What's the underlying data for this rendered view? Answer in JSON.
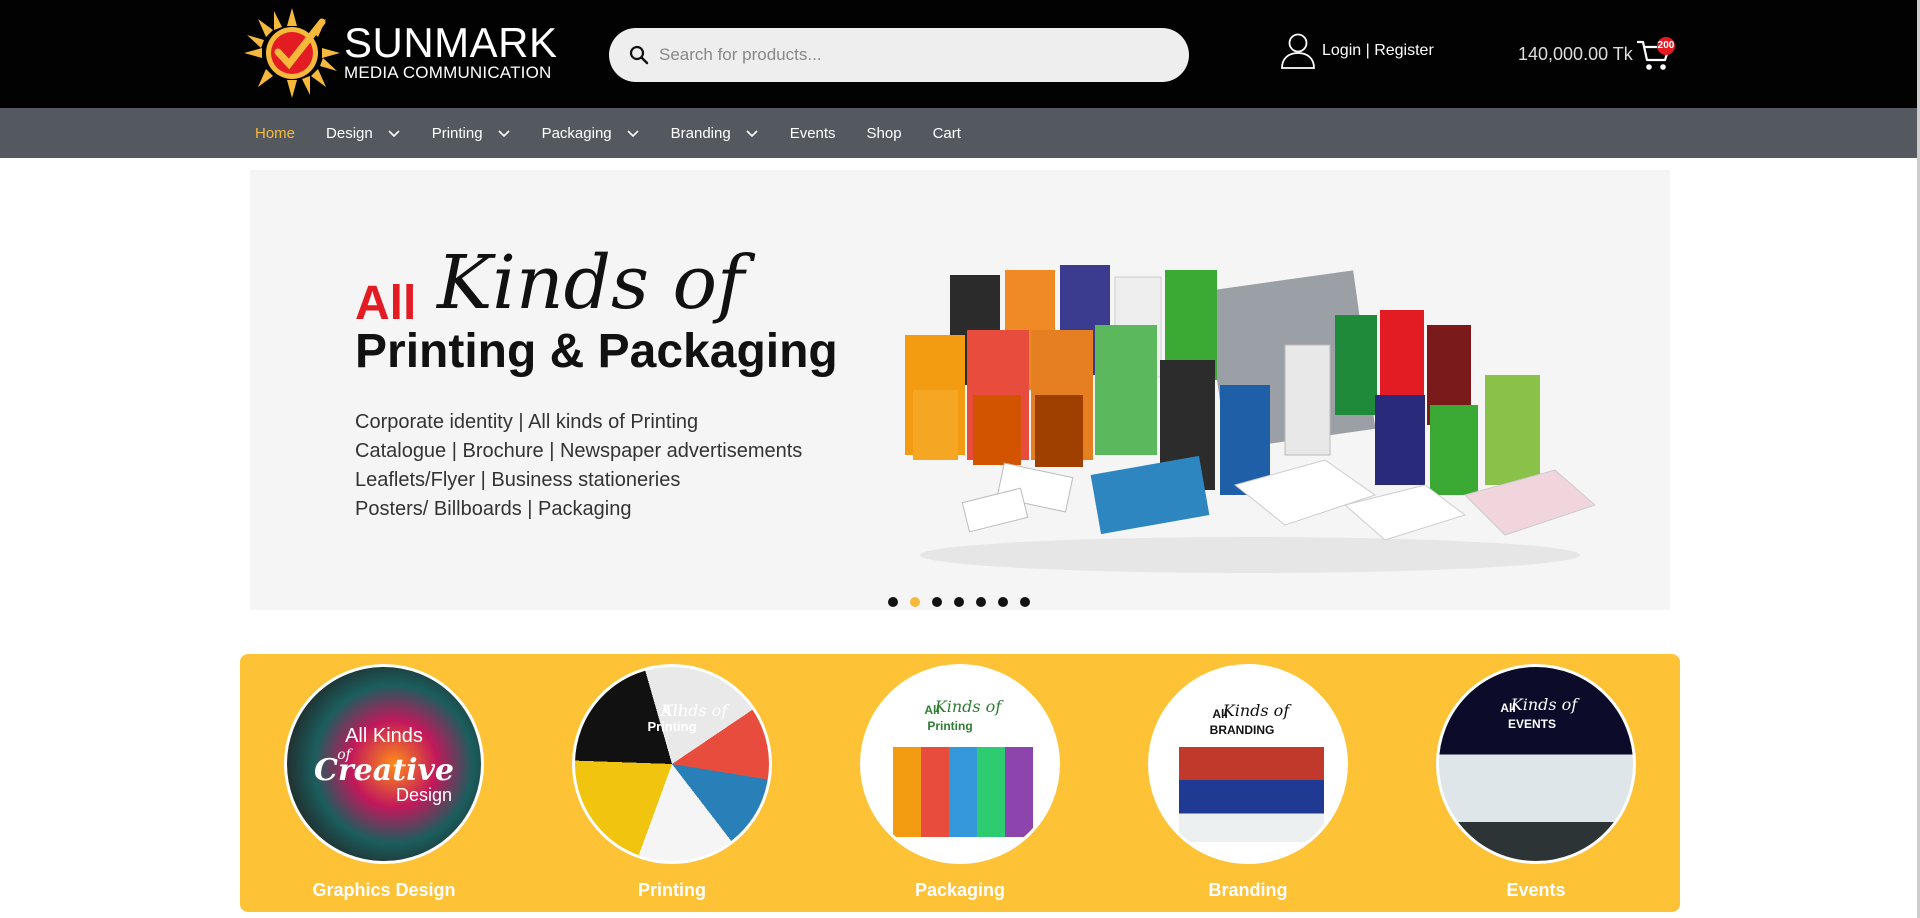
{
  "header": {
    "logo": {
      "name": "SUNMARK",
      "subtitle": "MEDIA COMMUNICATION"
    },
    "search": {
      "placeholder": "Search for products..."
    },
    "account": {
      "label": "Login | Register"
    },
    "cart": {
      "total": "140,000.00 Tk",
      "badge": "200"
    }
  },
  "nav": {
    "items": [
      {
        "label": "Home",
        "active": true,
        "dropdown": false
      },
      {
        "label": "Design",
        "dropdown": true
      },
      {
        "label": "Printing",
        "dropdown": true
      },
      {
        "label": "Packaging",
        "dropdown": true
      },
      {
        "label": "Branding",
        "dropdown": true
      },
      {
        "label": "Events",
        "dropdown": false
      },
      {
        "label": "Shop",
        "dropdown": false
      },
      {
        "label": "Cart",
        "dropdown": false
      }
    ]
  },
  "hero": {
    "all": "All",
    "kinds": "Kinds of",
    "headline": "Printing & Packaging",
    "lines": [
      "Corporate identity | All kinds of Printing",
      "Catalogue | Brochure | Newspaper advertisements",
      "Leaflets/Flyer | Business stationeries",
      "Posters/ Billboards | Packaging"
    ],
    "dots": 7,
    "active_dot": 1
  },
  "categories": [
    {
      "label": "Graphics Design",
      "image_text": [
        "All Kinds",
        "of",
        "Creative",
        "Design"
      ]
    },
    {
      "label": "Printing",
      "image_text": [
        "All",
        "Kinds of",
        "Printing"
      ]
    },
    {
      "label": "Packaging",
      "image_text": [
        "All",
        "Kinds of",
        "Printing"
      ]
    },
    {
      "label": "Branding",
      "image_text": [
        "All",
        "Kinds of",
        "BRANDING"
      ]
    },
    {
      "label": "Events",
      "image_text": [
        "All",
        "Kinds of",
        "EVENTS"
      ]
    }
  ],
  "colors": {
    "accent": "#fdc236",
    "nav_bg": "#54595f",
    "topbar_bg": "#020202",
    "brand_red": "#e31b23"
  }
}
